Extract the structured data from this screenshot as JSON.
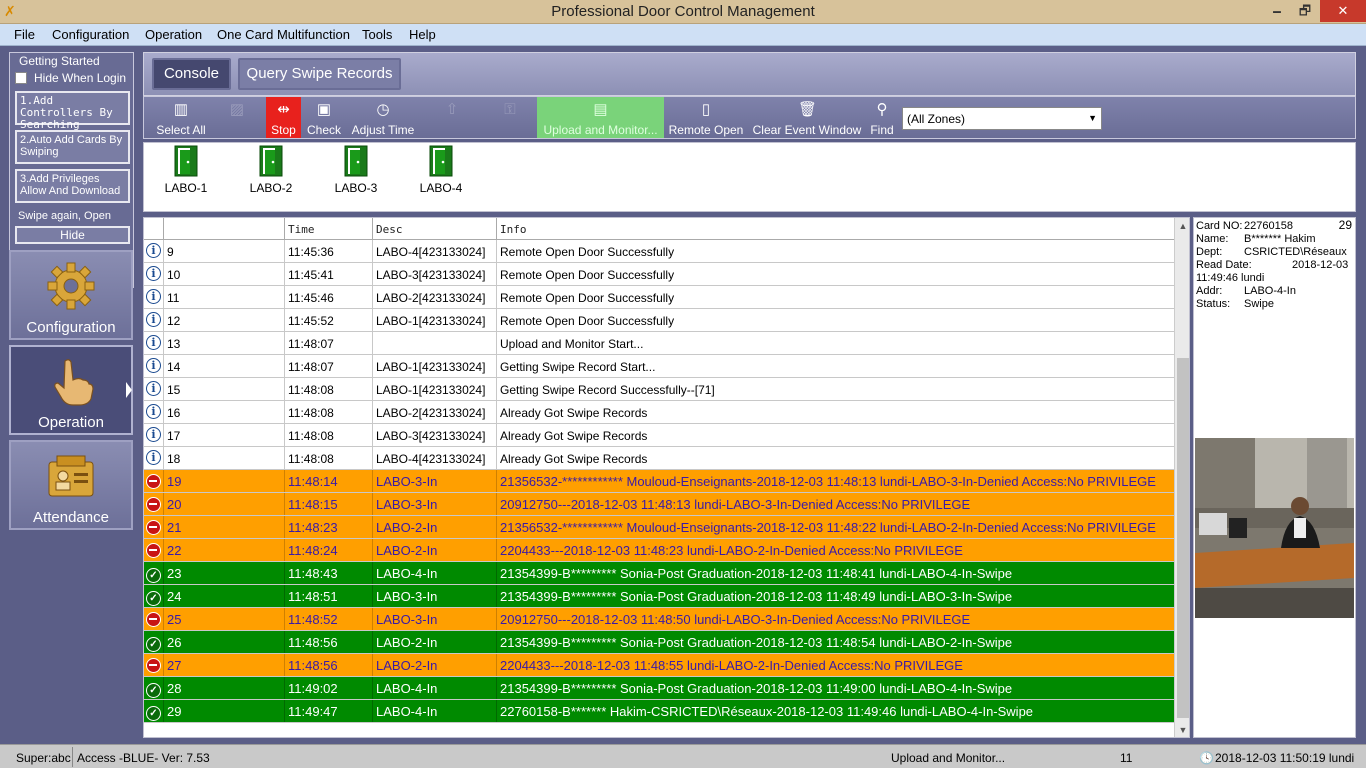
{
  "window": {
    "title": "Professional Door Control Management",
    "min": "🗕",
    "max": "🗗",
    "close": "✕"
  },
  "menu": [
    "File",
    "Configuration",
    "Operation",
    "One Card Multifunction",
    "Tools",
    "Help"
  ],
  "getting_started": {
    "title": "Getting Started",
    "hide_when_login": "Hide When Login",
    "steps": [
      "1.Add Controllers By Searching",
      "2.Auto Add Cards By Swiping",
      "3.Add Privileges Allow And Download"
    ],
    "swipe_again": "Swipe again, Open",
    "hide": "Hide"
  },
  "nav": [
    {
      "label": "Configuration",
      "icon": "gear-icon"
    },
    {
      "label": "Operation",
      "icon": "hand-pointer-icon"
    },
    {
      "label": "Attendance",
      "icon": "id-card-icon"
    }
  ],
  "top_tabs": {
    "console": "Console",
    "query": "Query Swipe Records"
  },
  "toolbar": {
    "select_all": "Select All",
    "stop": "Stop",
    "check": "Check",
    "adjust_time": "Adjust Time",
    "upload": "Upload and Monitor...",
    "remote_open": "Remote Open",
    "clear": "Clear Event Window",
    "find": "Find",
    "zone": "(All Zones)"
  },
  "doors": [
    "LABO-1",
    "LABO-2",
    "LABO-3",
    "LABO-4"
  ],
  "log": {
    "headers": {
      "time": "Time",
      "desc": "Desc",
      "info": "Info"
    },
    "rows": [
      {
        "type": "info",
        "id": "9",
        "time": "11:45:36",
        "desc": "LABO-4[423133024]",
        "info": "Remote Open Door Successfully"
      },
      {
        "type": "info",
        "id": "10",
        "time": "11:45:41",
        "desc": "LABO-3[423133024]",
        "info": "Remote Open Door Successfully"
      },
      {
        "type": "info",
        "id": "11",
        "time": "11:45:46",
        "desc": "LABO-2[423133024]",
        "info": "Remote Open Door Successfully"
      },
      {
        "type": "info",
        "id": "12",
        "time": "11:45:52",
        "desc": "LABO-1[423133024]",
        "info": "Remote Open Door Successfully"
      },
      {
        "type": "info",
        "id": "13",
        "time": "11:48:07",
        "desc": "",
        "info": "Upload and Monitor Start..."
      },
      {
        "type": "info",
        "id": "14",
        "time": "11:48:07",
        "desc": "LABO-1[423133024]",
        "info": "Getting Swipe Record Start..."
      },
      {
        "type": "info",
        "id": "15",
        "time": "11:48:08",
        "desc": "LABO-1[423133024]",
        "info": "Getting Swipe Record Successfully--[71]"
      },
      {
        "type": "info",
        "id": "16",
        "time": "11:48:08",
        "desc": "LABO-2[423133024]",
        "info": "Already Got Swipe Records"
      },
      {
        "type": "info",
        "id": "17",
        "time": "11:48:08",
        "desc": "LABO-3[423133024]",
        "info": "Already Got Swipe Records"
      },
      {
        "type": "info",
        "id": "18",
        "time": "11:48:08",
        "desc": "LABO-4[423133024]",
        "info": "Already Got Swipe Records"
      },
      {
        "type": "denied",
        "id": "19",
        "time": "11:48:14",
        "desc": "LABO-3-In",
        "info": "21356532-************  Mouloud-Enseignants-2018-12-03 11:48:13 lundi-LABO-3-In-Denied Access:No PRIVILEGE"
      },
      {
        "type": "denied",
        "id": "20",
        "time": "11:48:15",
        "desc": "LABO-3-In",
        "info": "20912750---2018-12-03 11:48:13 lundi-LABO-3-In-Denied Access:No PRIVILEGE"
      },
      {
        "type": "denied",
        "id": "21",
        "time": "11:48:23",
        "desc": "LABO-2-In",
        "info": "21356532-************  Mouloud-Enseignants-2018-12-03 11:48:22 lundi-LABO-2-In-Denied Access:No PRIVILEGE"
      },
      {
        "type": "denied",
        "id": "22",
        "time": "11:48:24",
        "desc": "LABO-2-In",
        "info": "2204433---2018-12-03 11:48:23 lundi-LABO-2-In-Denied Access:No PRIVILEGE"
      },
      {
        "type": "swipe",
        "id": "23",
        "time": "11:48:43",
        "desc": "LABO-4-In",
        "info": "21354399-B*********  Sonia-Post Graduation-2018-12-03 11:48:41 lundi-LABO-4-In-Swipe"
      },
      {
        "type": "swipe",
        "id": "24",
        "time": "11:48:51",
        "desc": "LABO-3-In",
        "info": "21354399-B*********  Sonia-Post Graduation-2018-12-03 11:48:49 lundi-LABO-3-In-Swipe"
      },
      {
        "type": "denied",
        "id": "25",
        "time": "11:48:52",
        "desc": "LABO-3-In",
        "info": "20912750---2018-12-03 11:48:50 lundi-LABO-3-In-Denied Access:No PRIVILEGE"
      },
      {
        "type": "swipe",
        "id": "26",
        "time": "11:48:56",
        "desc": "LABO-2-In",
        "info": "21354399-B*********  Sonia-Post Graduation-2018-12-03 11:48:54 lundi-LABO-2-In-Swipe"
      },
      {
        "type": "denied",
        "id": "27",
        "time": "11:48:56",
        "desc": "LABO-2-In",
        "info": "2204433---2018-12-03 11:48:55 lundi-LABO-2-In-Denied Access:No PRIVILEGE"
      },
      {
        "type": "swipe",
        "id": "28",
        "time": "11:49:02",
        "desc": "LABO-4-In",
        "info": "21354399-B*********  Sonia-Post Graduation-2018-12-03 11:49:00 lundi-LABO-4-In-Swipe"
      },
      {
        "type": "swipe",
        "id": "29",
        "time": "11:49:47",
        "desc": "LABO-4-In",
        "info": "22760158-B*******  Hakim-CSRICTED\\Réseaux-2018-12-03 11:49:46 lundi-LABO-4-In-Swipe"
      }
    ]
  },
  "card": {
    "count": "29",
    "card_no_label": "Card NO:",
    "card_no": "22760158",
    "name_label": "Name:",
    "name": "B*******  Hakim",
    "dept_label": "Dept:",
    "dept": "CSRICTED\\Réseaux",
    "read_date_label": "Read Date:",
    "read_date": "2018-12-03",
    "read_time": "11:49:46 lundi",
    "addr_label": "Addr:",
    "addr": "LABO-4-In",
    "status_label": "Status:",
    "status": "Swipe"
  },
  "status": {
    "user": "Super:abc",
    "version": "Access -BLUE- Ver: 7.53",
    "task": "Upload and Monitor...",
    "count": "11",
    "datetime": "2018-12-03 11:50:19 lundi"
  },
  "colors": {
    "denied_bg": "#ff9f00",
    "swipe_bg": "#008a00",
    "stop_bg": "#e8211d",
    "upload_bg": "#7ad37a"
  }
}
